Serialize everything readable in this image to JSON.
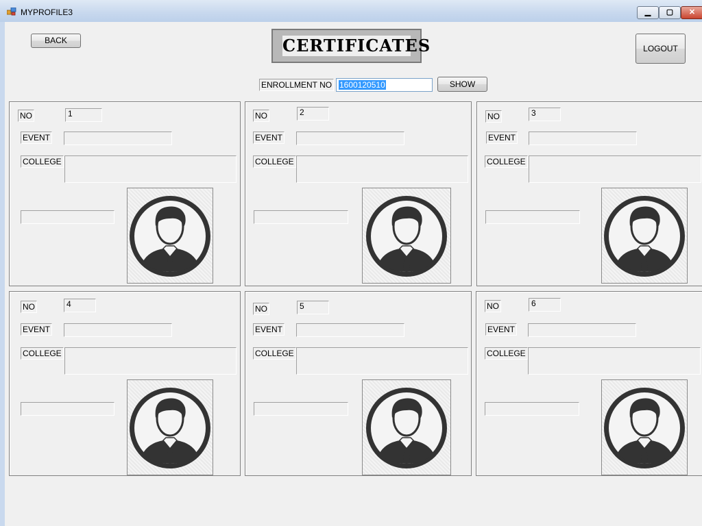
{
  "window": {
    "title": "MYPROFILE3",
    "min_glyph": "▁",
    "max_glyph": "▢",
    "close_glyph": "✕"
  },
  "header": {
    "back_label": "BACK",
    "title": "CERTIFICATES",
    "logout_label": "LOGOUT"
  },
  "enrollment": {
    "label": "ENROLLMENT NO",
    "value": "1600120510",
    "show_label": "SHOW"
  },
  "labels": {
    "no": "NO",
    "event": "EVENT",
    "college": "COLLEGE"
  },
  "cards": [
    {
      "no": "1",
      "event": "",
      "college": "",
      "extra": ""
    },
    {
      "no": "2",
      "event": "",
      "college": "",
      "extra": ""
    },
    {
      "no": "3",
      "event": "",
      "college": "",
      "extra": ""
    },
    {
      "no": "4",
      "event": "",
      "college": "",
      "extra": ""
    },
    {
      "no": "5",
      "event": "",
      "college": "",
      "extra": ""
    },
    {
      "no": "6",
      "event": "",
      "college": "",
      "extra": ""
    }
  ],
  "photo_icon": "user-avatar-icon"
}
